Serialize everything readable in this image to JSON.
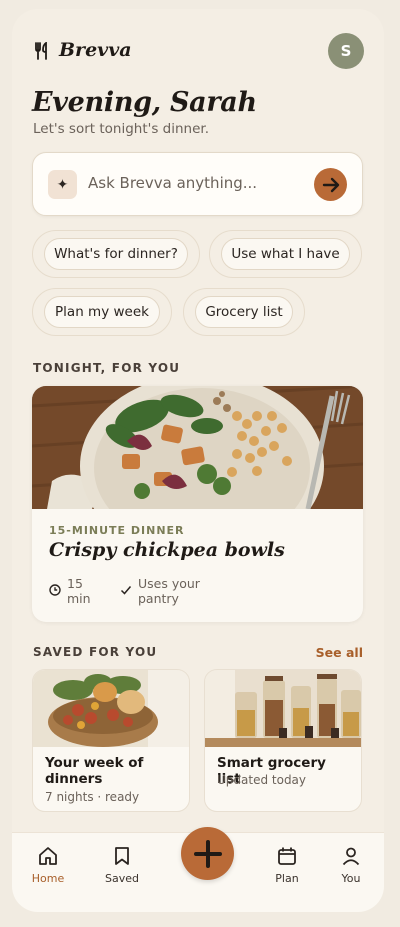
{
  "app": {
    "name": "Brevva",
    "avatar_initial": "S"
  },
  "greeting": {
    "title": "Evening, Sarah",
    "subtitle": "Let's sort tonight's dinner."
  },
  "search": {
    "placeholder": "Ask Brevva anything..."
  },
  "chips": [
    "What's for dinner?",
    "Use what I have",
    "Plan my week",
    "Grocery list"
  ],
  "tonight": {
    "section_label": "TONIGHT, FOR YOU",
    "kicker": "15-MINUTE DINNER",
    "title": "Crispy chickpea bowls",
    "time_line1": "15",
    "time_line2": "min",
    "pantry_line1": "Uses your",
    "pantry_line2": "pantry"
  },
  "saved": {
    "section_label": "SAVED FOR YOU",
    "see_all": "See all",
    "cards": [
      {
        "title_line1": "Your week of",
        "title_line2": "dinners",
        "subtitle": "7 nights · ready"
      },
      {
        "title_line1": "Smart grocery list",
        "subtitle": "Updated today"
      }
    ]
  },
  "tabs": [
    {
      "label": "Home",
      "icon": "home-icon",
      "active": true
    },
    {
      "label": "Saved",
      "icon": "bookmark-icon"
    },
    {
      "label": "Plan",
      "icon": "calendar-icon"
    },
    {
      "label": "You",
      "icon": "user-icon"
    }
  ],
  "colors": {
    "accent": "#b96a37",
    "background": "#f4eee4",
    "card": "#fbf8f2",
    "olive": "#7b7d57",
    "avatar": "#8a9076"
  }
}
